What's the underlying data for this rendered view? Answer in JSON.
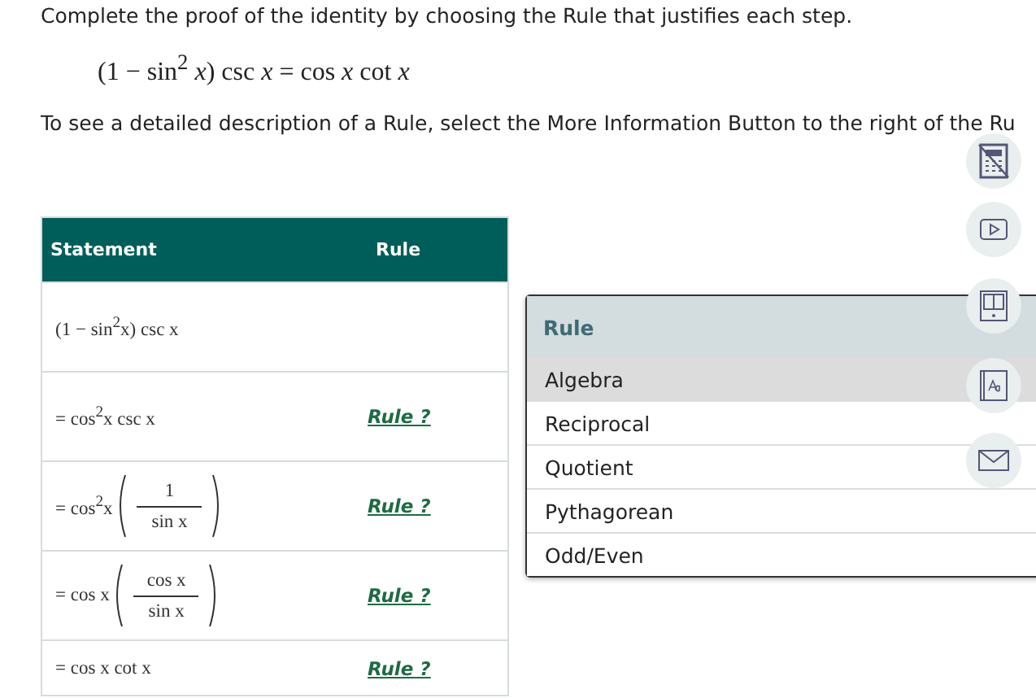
{
  "instruction": "Complete the proof of the identity by choosing the Rule that justifies each step.",
  "identity": "(1 − sin$^{2}$ *x*) csc *x* = cos *x* cot *x*",
  "hint": "To see a detailed description of a Rule, select the More Information Button to the right of the Ru",
  "table": {
    "columns": [
      "Statement",
      "Rule"
    ],
    "rows": [
      {
        "statement": {
          "kind": "plain",
          "text": "(1 − sin$^{2}$x) csc x"
        }
      },
      {
        "statement": {
          "kind": "plain",
          "text": "= cos$^{2}$x csc x"
        },
        "rule": "Rule ?"
      },
      {
        "statement": {
          "kind": "fraction",
          "prefix": "= cos$^{2}$x",
          "numerator": "1",
          "denominator": "sin x"
        },
        "rule": "Rule ?"
      },
      {
        "statement": {
          "kind": "fraction",
          "prefix": "= cos x",
          "numerator": "cos x",
          "denominator": "sin x"
        },
        "rule": "Rule ?"
      },
      {
        "statement": {
          "kind": "plain",
          "text": "= cos x cot x"
        },
        "rule": "Rule ?"
      }
    ]
  },
  "rule_menu": {
    "title": "Rule",
    "options": [
      {
        "label": "Algebra",
        "selected": true
      },
      {
        "label": "Reciprocal",
        "selected": false
      },
      {
        "label": "Quotient",
        "selected": false
      },
      {
        "label": "Pythagorean",
        "selected": false
      },
      {
        "label": "Odd/Even",
        "selected": false
      }
    ]
  }
}
